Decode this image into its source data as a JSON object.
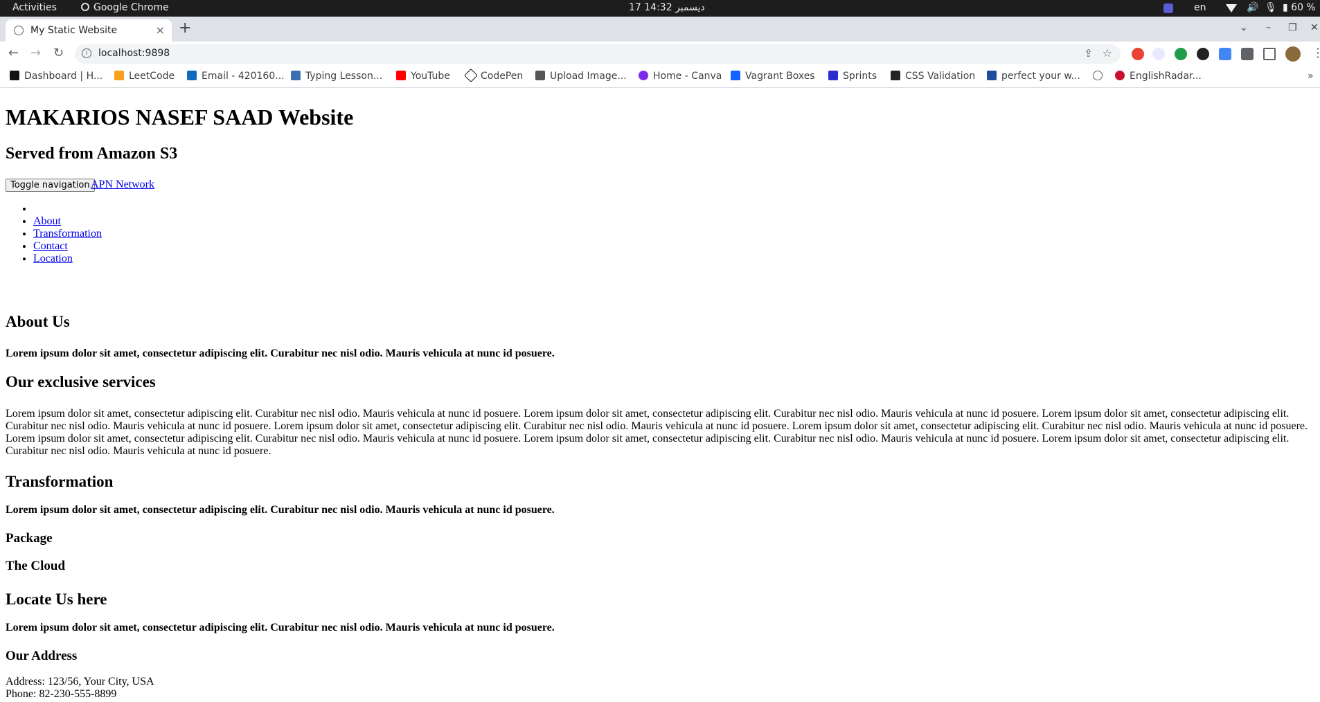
{
  "os": {
    "activities": "Activities",
    "app": "Google Chrome",
    "clock": "17 ديسمبر  14:32",
    "lang": "en",
    "battery": "60 %"
  },
  "browser": {
    "tab_title": "My Static Website",
    "tab_close": "×",
    "new_tab": "+",
    "url": "localhost:9898"
  },
  "bookmarks": [
    {
      "label": "Dashboard | H...",
      "color": "#111111"
    },
    {
      "label": "LeetCode",
      "color": "#f89f1b"
    },
    {
      "label": "Email - 420160...",
      "color": "#0f6cbd"
    },
    {
      "label": "Typing Lesson...",
      "color": "#3a6fb0"
    },
    {
      "label": "YouTube",
      "color": "#ff0000"
    },
    {
      "label": "CodePen",
      "color": "#111111"
    },
    {
      "label": "Upload Image...",
      "color": "#555555"
    },
    {
      "label": "Home - Canva",
      "color": "#7d2ae8"
    },
    {
      "label": "Vagrant Boxes",
      "color": "#1563ff"
    },
    {
      "label": "Sprints",
      "color": "#2b2bd0"
    },
    {
      "label": "CSS Validation",
      "color": "#222222"
    },
    {
      "label": "perfect your w...",
      "color": "#1f4e9c"
    },
    {
      "label": "",
      "color": "#5f6368"
    },
    {
      "label": "EnglishRadar...",
      "color": "#c8102e"
    }
  ],
  "page": {
    "title": "MAKARIOS NASEF SAAD Website",
    "subtitle": "Served from Amazon S3",
    "toggle_label": "Toggle navigation",
    "brand_link": "APN Network",
    "nav": [
      "About",
      "Transformation",
      "Contact",
      "Location"
    ],
    "about_heading": "About Us",
    "about_text": "Lorem ipsum dolor sit amet, consectetur adipiscing elit. Curabitur nec nisl odio. Mauris vehicula at nunc id posuere.",
    "services_heading": "Our exclusive services",
    "services_text": "Lorem ipsum dolor sit amet, consectetur adipiscing elit. Curabitur nec nisl odio. Mauris vehicula at nunc id posuere. Lorem ipsum dolor sit amet, consectetur adipiscing elit. Curabitur nec nisl odio. Mauris vehicula at nunc id posuere. Lorem ipsum dolor sit amet, consectetur adipiscing elit. Curabitur nec nisl odio. Mauris vehicula at nunc id posuere. Lorem ipsum dolor sit amet, consectetur adipiscing elit. Curabitur nec nisl odio. Mauris vehicula at nunc id posuere. Lorem ipsum dolor sit amet, consectetur adipiscing elit. Curabitur nec nisl odio. Mauris vehicula at nunc id posuere. Lorem ipsum dolor sit amet, consectetur adipiscing elit. Curabitur nec nisl odio. Mauris vehicula at nunc id posuere. Lorem ipsum dolor sit amet, consectetur adipiscing elit. Curabitur nec nisl odio. Mauris vehicula at nunc id posuere. Lorem ipsum dolor sit amet, consectetur adipiscing elit. Curabitur nec nisl odio. Mauris vehicula at nunc id posuere.",
    "transformation_heading": "Transformation",
    "transformation_text": "Lorem ipsum dolor sit amet, consectetur adipiscing elit. Curabitur nec nisl odio. Mauris vehicula at nunc id posuere.",
    "package_heading": "Package",
    "cloud_heading": "The Cloud",
    "locate_heading": "Locate Us here",
    "locate_text": "Lorem ipsum dolor sit amet, consectetur adipiscing elit. Curabitur nec nisl odio. Mauris vehicula at nunc id posuere.",
    "address_heading": "Our Address",
    "address_line": "Address: 123/56, Your City, USA",
    "phone_line": "Phone: 82-230-555-8899"
  }
}
